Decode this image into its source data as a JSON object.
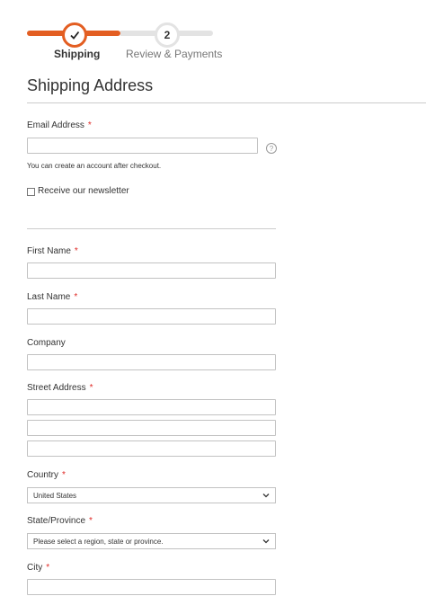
{
  "progress": {
    "steps": [
      {
        "label": "Shipping",
        "status": "complete"
      },
      {
        "number": "2",
        "label": "Review & Payments",
        "status": "upcoming"
      }
    ],
    "accent_color": "#e35e22"
  },
  "form": {
    "title": "Shipping Address",
    "required_marker": "*",
    "email": {
      "label": "Email Address",
      "value": "",
      "help": "?",
      "note": "You can create an account after checkout."
    },
    "newsletter": {
      "label": "Receive our newsletter",
      "checked": false
    },
    "first_name": {
      "label": "First Name",
      "value": ""
    },
    "last_name": {
      "label": "Last Name",
      "value": ""
    },
    "company": {
      "label": "Company",
      "value": ""
    },
    "street": {
      "label": "Street Address",
      "lines": [
        "",
        "",
        ""
      ]
    },
    "country": {
      "label": "Country",
      "selected": "United States"
    },
    "state": {
      "label": "State/Province",
      "selected": "Please select a region, state or province."
    },
    "city": {
      "label": "City",
      "value": ""
    }
  }
}
